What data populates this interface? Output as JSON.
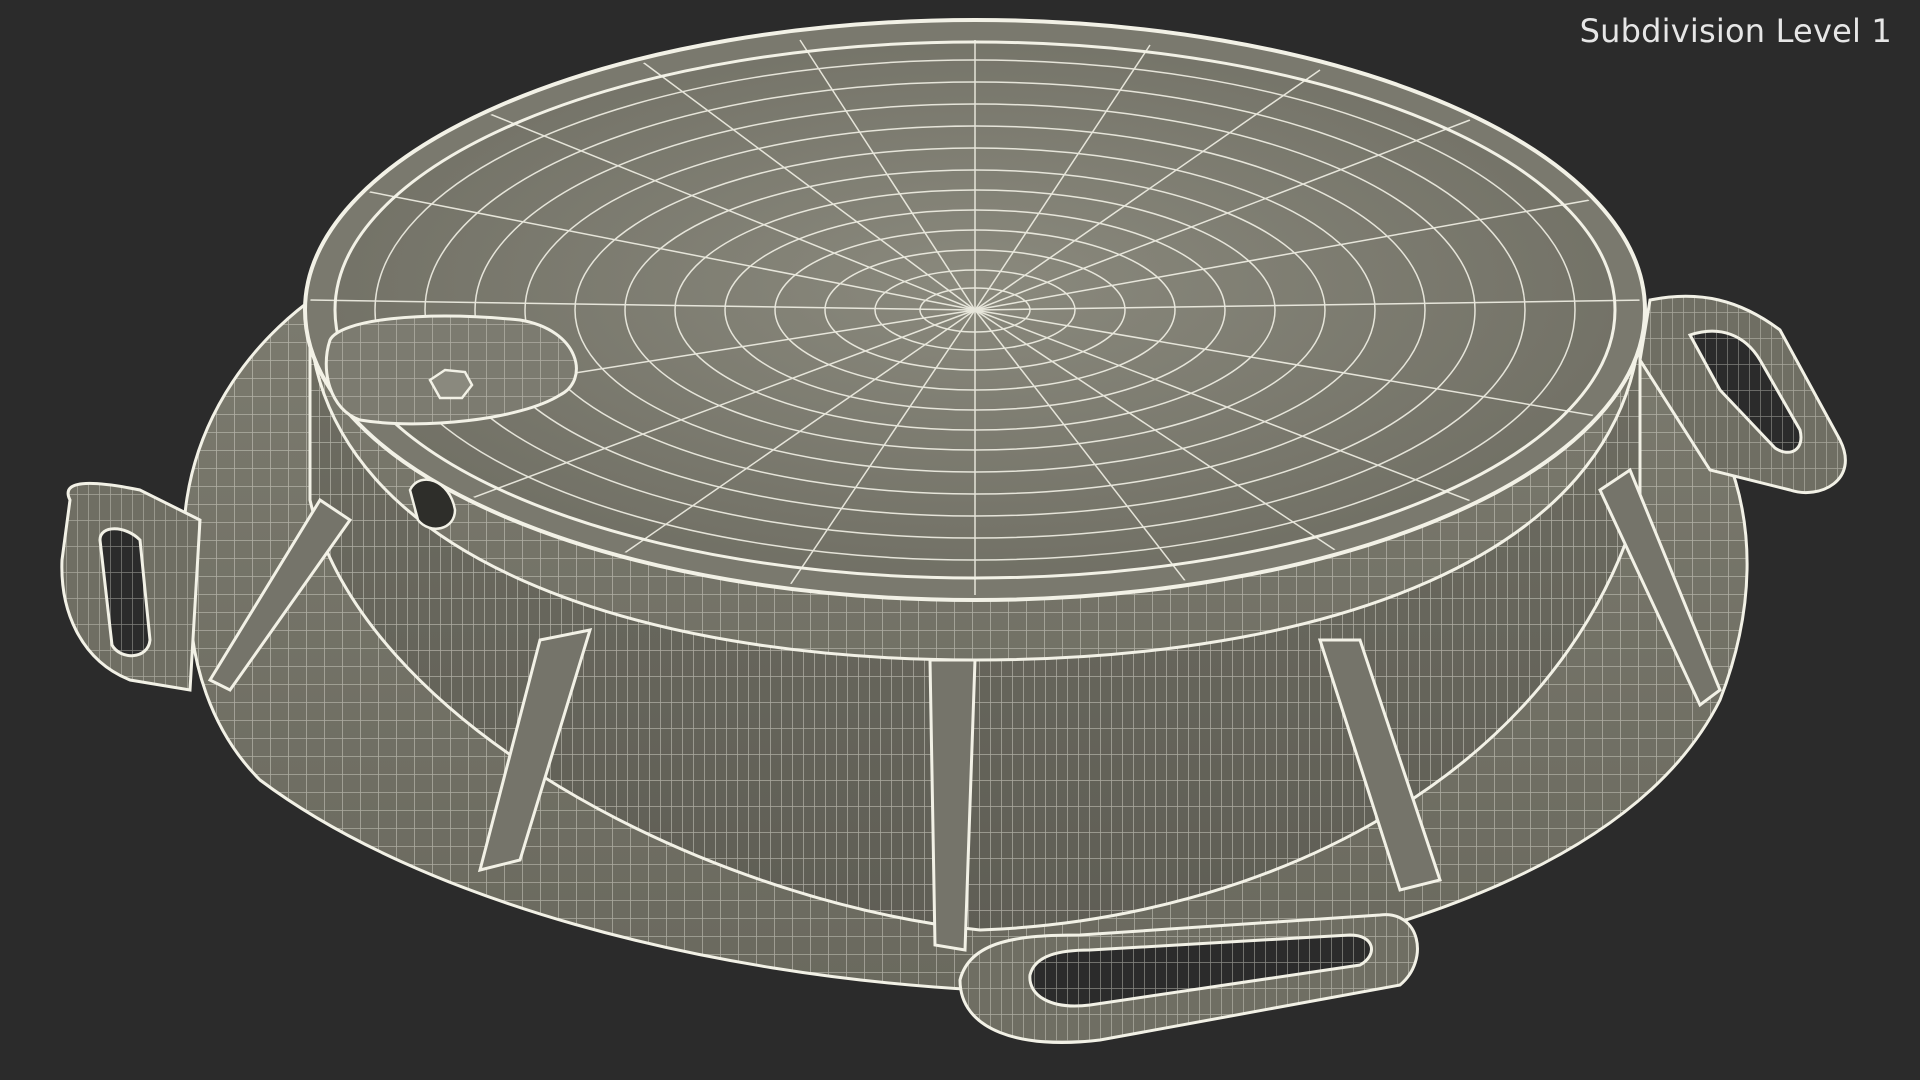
{
  "viewport": {
    "label": "Subdivision Level 1"
  },
  "colors": {
    "background": "#2b2b2b",
    "surface": "#7d7c70",
    "wire": "#f2f1e6"
  }
}
